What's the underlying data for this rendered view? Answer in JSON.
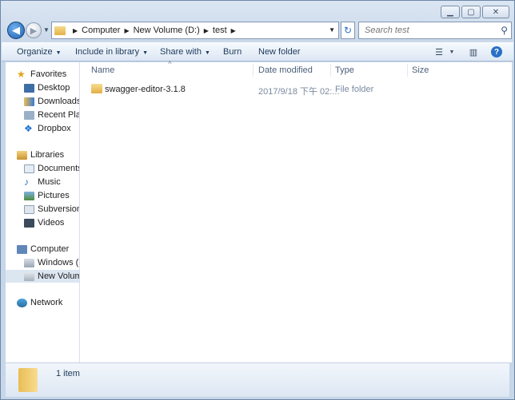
{
  "window": {
    "controls": [
      "minimize",
      "maximize",
      "close"
    ]
  },
  "address": {
    "crumbs": [
      "Computer",
      "New Volume (D:)",
      "test"
    ]
  },
  "search": {
    "placeholder": "Search test"
  },
  "toolbar": {
    "organize": "Organize",
    "include_in_library": "Include in library",
    "share_with": "Share with",
    "burn": "Burn",
    "new_folder": "New folder"
  },
  "nav": {
    "favorites": "Favorites",
    "desktop": "Desktop",
    "downloads": "Downloads",
    "recent_places": "Recent Places",
    "dropbox": "Dropbox",
    "libraries": "Libraries",
    "documents": "Documents",
    "music": "Music",
    "pictures": "Pictures",
    "subversion": "Subversion",
    "videos": "Videos",
    "computer": "Computer",
    "windows_c": "Windows (C:)",
    "new_volume": "New Volume (D:)",
    "network": "Network"
  },
  "columns": {
    "name": "Name",
    "date_modified": "Date modified",
    "type": "Type",
    "size": "Size"
  },
  "files": [
    {
      "name": "swagger-editor-3.1.8",
      "date": "2017/9/18 下午 02:...",
      "type": "File folder",
      "size": ""
    }
  ],
  "status": {
    "count": "1 item"
  }
}
